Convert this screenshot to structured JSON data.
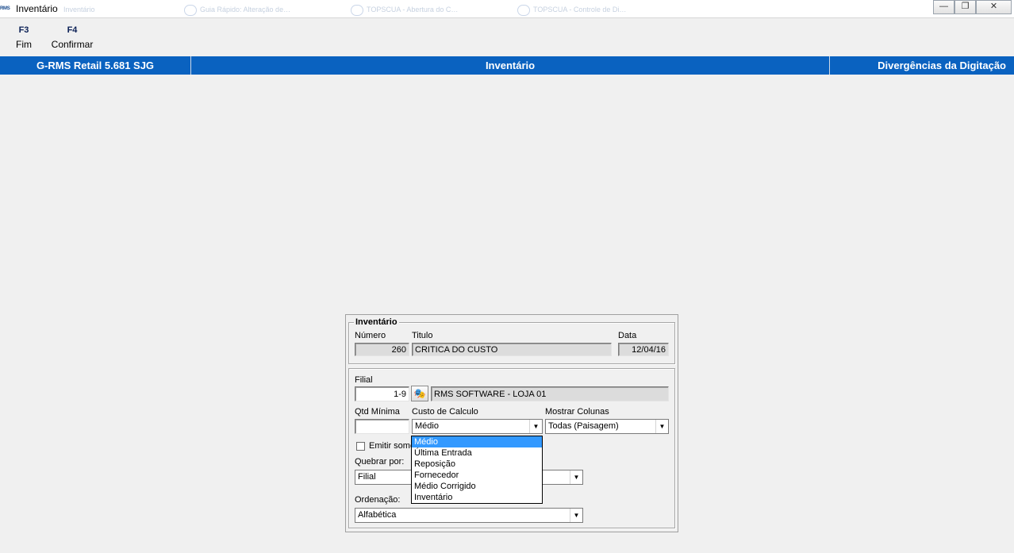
{
  "window": {
    "title": "Inventário",
    "logo_text": "RMS",
    "ghost_tabs": [
      "Inventário",
      "Guia Rápido: Alteração de…",
      "TOPSCUA - Abertura do C…",
      "TOPSCUA - Controle de Di…"
    ]
  },
  "toolbar": {
    "keys": [
      {
        "key": "F3",
        "label": "Fim"
      },
      {
        "key": "F4",
        "label": "Confirmar"
      }
    ]
  },
  "header": {
    "app_version": "G-RMS Retail 5.681 SJG",
    "module": "Inventário",
    "screen": "Divergências da Digitação",
    "color": "#0a62c0"
  },
  "dialog": {
    "inventario": {
      "title": "Inventário",
      "numero_label": "Número",
      "numero_value": "260",
      "titulo_label": "Titulo",
      "titulo_value": "CRITICA DO CUSTO",
      "data_label": "Data",
      "data_value": "12/04/16"
    },
    "filial_label": "Filial",
    "filial_code": "1-9",
    "filial_name": "RMS SOFTWARE - LOJA 01",
    "qtd_minima_label": "Qtd Mínima",
    "qtd_minima_value": "",
    "custo_label": "Custo de Calculo",
    "custo_value": "Médio",
    "custo_options": [
      "Médio",
      "Última Entrada",
      "Reposição",
      "Fornecedor",
      "Médio Corrigido",
      "Inventário"
    ],
    "custo_selected_index": 0,
    "mostrar_colunas_label": "Mostrar Colunas",
    "mostrar_colunas_value": "Todas (Paisagem)",
    "emitir_label": "Emitir some",
    "emitir_checked": false,
    "quebrar_label": "Quebrar por:",
    "quebrar_value": "Filial",
    "ordenacao_label": "Ordenação:",
    "ordenacao_value": "Alfabética"
  }
}
